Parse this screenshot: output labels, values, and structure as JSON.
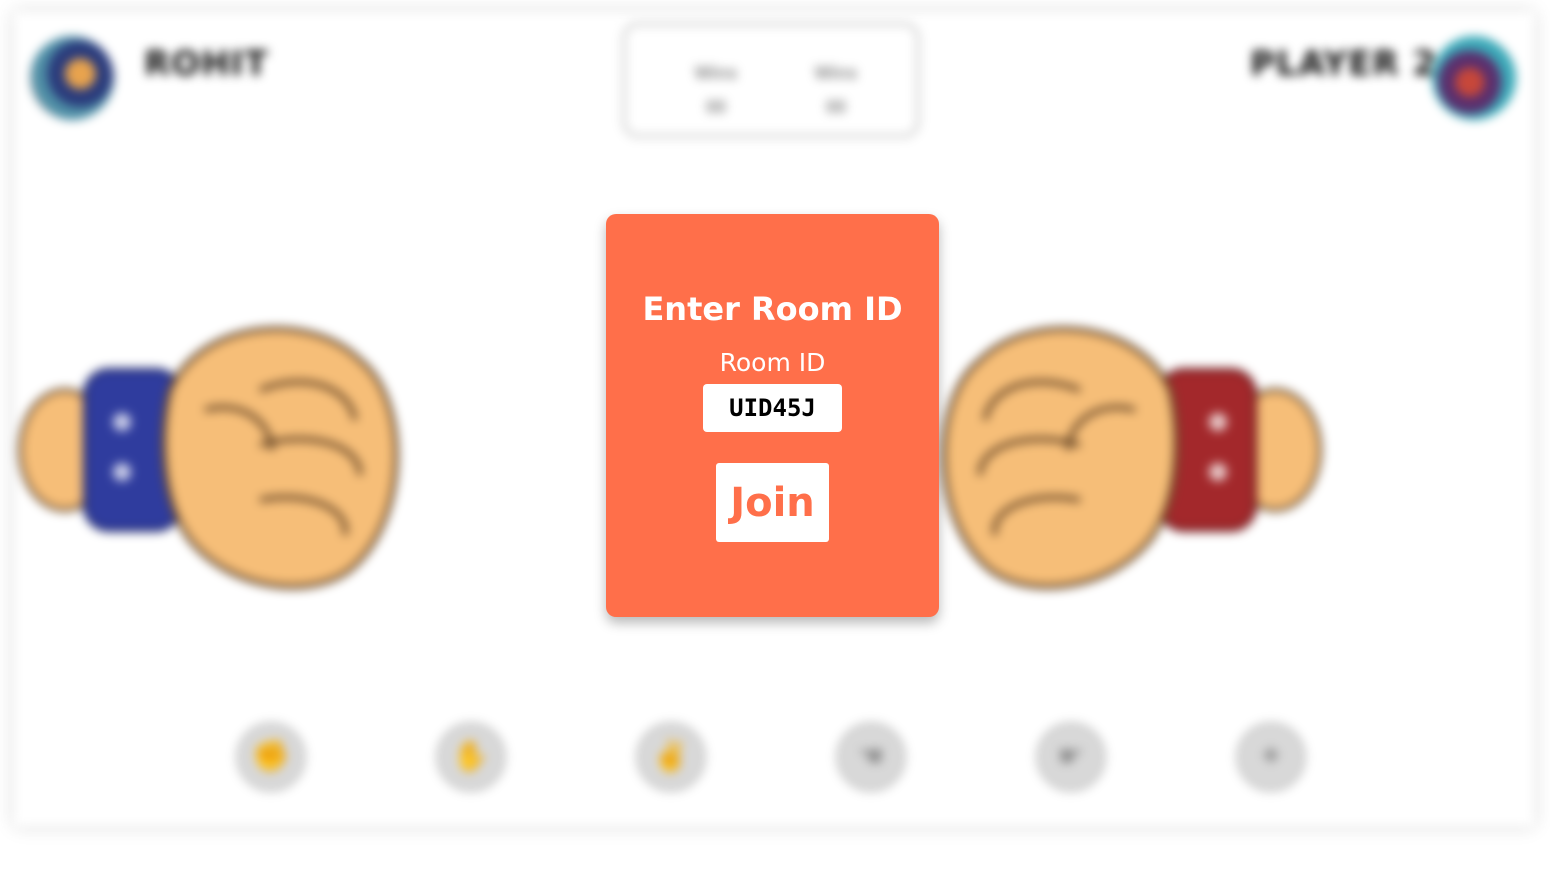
{
  "players": {
    "left": {
      "name": "ROHIT"
    },
    "right": {
      "name": "PLAYER 2"
    }
  },
  "scoreboard": {
    "p1_label": "Wins",
    "p1_value": "00",
    "p2_label": "Wins",
    "p2_value": "00"
  },
  "moves": [
    {
      "icon": "rock-hand-icon"
    },
    {
      "icon": "paper-hand-icon"
    },
    {
      "icon": "scissors-hand-icon"
    },
    {
      "icon": "lizard-hand-icon"
    },
    {
      "icon": "spock-hand-icon"
    },
    {
      "icon": "random-icon"
    }
  ],
  "colors": {
    "modal_bg": "#ff6f4a",
    "left_cuff": "#2f3c9e",
    "right_cuff": "#a3282b",
    "skin": "#f6be78"
  },
  "modal": {
    "title": "Enter Room ID",
    "field_label": "Room ID",
    "room_id_value": "UID45J",
    "join_label": "Join"
  }
}
